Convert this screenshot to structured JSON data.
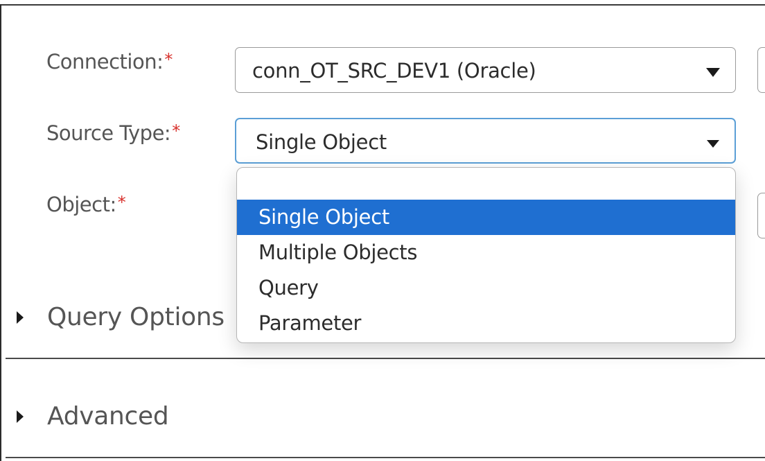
{
  "form": {
    "connection": {
      "label": "Connection:",
      "required_mark": "*",
      "value": "conn_OT_SRC_DEV1 (Oracle)"
    },
    "source_type": {
      "label": "Source Type:",
      "required_mark": "*",
      "value": "Single Object",
      "options": [
        "",
        "Single Object",
        "Multiple Objects",
        "Query",
        "Parameter"
      ],
      "selected_index": 1
    },
    "object": {
      "label": "Object:",
      "required_mark": "*"
    }
  },
  "sections": {
    "query_options": {
      "title": "Query Options",
      "expanded": false
    },
    "advanced": {
      "title": "Advanced",
      "expanded": false
    }
  },
  "colors": {
    "required": "#d8302b",
    "selected_option_bg": "#1f6fd1",
    "focus_border": "#5b9fd6"
  },
  "icons": {
    "dropdown": "chevron-down-icon",
    "collapse": "caret-right-icon"
  }
}
